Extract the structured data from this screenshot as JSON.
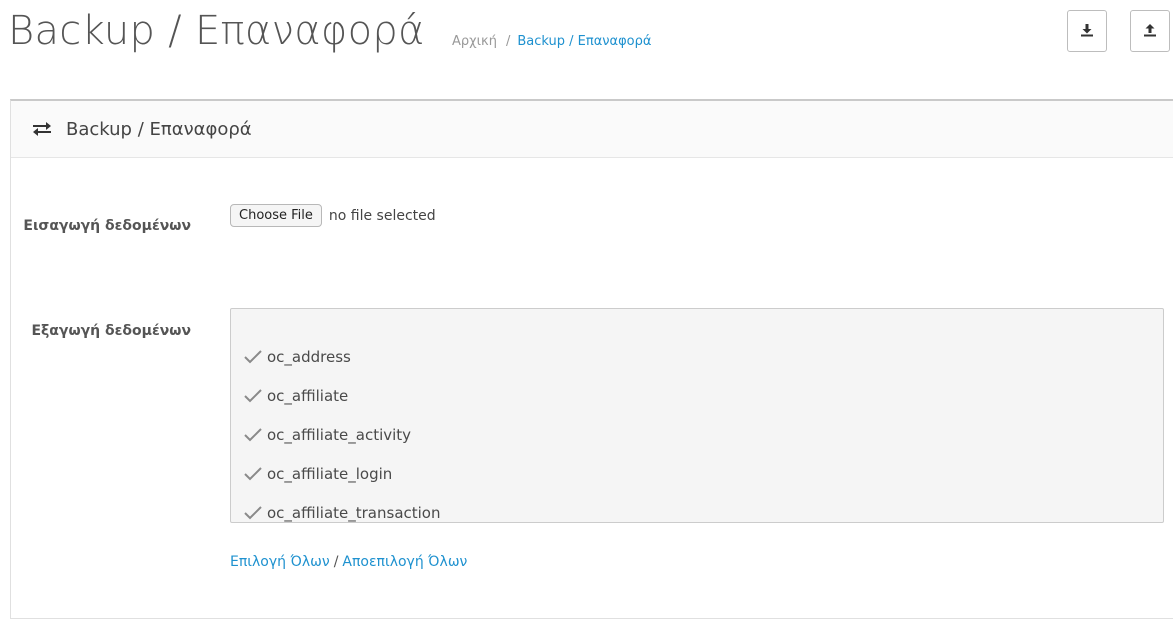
{
  "header": {
    "title": "Backup / Επαναφορά",
    "breadcrumb": {
      "home": "Αρχική",
      "separator": "/",
      "current": "Backup / Επαναφορά"
    },
    "buttons": [
      {
        "icon": "download-icon"
      },
      {
        "icon": "upload-icon"
      }
    ]
  },
  "panel": {
    "icon": "exchange-icon",
    "title": "Backup / Επαναφορά",
    "import": {
      "label": "Εισαγωγή δεδομένων",
      "button_label": "Choose File",
      "status": "no file selected"
    },
    "export": {
      "label": "Εξαγωγή δεδομένων",
      "tables": [
        {
          "name": "oc_address",
          "checked": true
        },
        {
          "name": "oc_affiliate",
          "checked": true
        },
        {
          "name": "oc_affiliate_activity",
          "checked": true
        },
        {
          "name": "oc_affiliate_login",
          "checked": true
        },
        {
          "name": "oc_affiliate_transaction",
          "checked": true
        }
      ]
    },
    "links": {
      "select_all": "Επιλογή Όλων",
      "separator": "/",
      "unselect_all": "Αποεπιλογή Όλων"
    }
  },
  "colors": {
    "link": "#1e91cf",
    "panel_heading_bg": "#fafafa",
    "export_box_bg": "#f5f5f5"
  }
}
